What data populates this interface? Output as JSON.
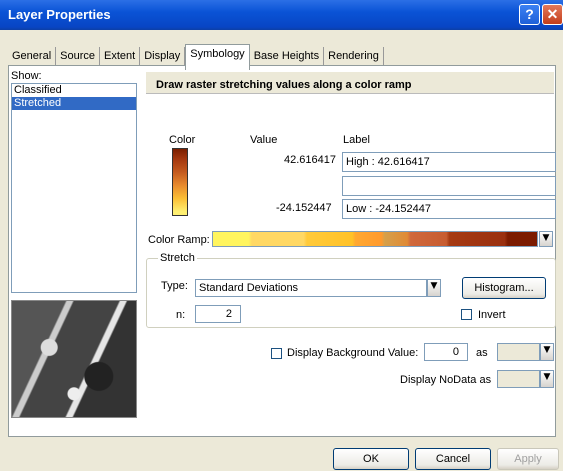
{
  "window": {
    "title": "Layer Properties"
  },
  "tabs": [
    "General",
    "Source",
    "Extent",
    "Display",
    "Symbology",
    "Base Heights",
    "Rendering"
  ],
  "active_tab": "Symbology",
  "show": {
    "label": "Show:",
    "items": [
      "Classified",
      "Stretched"
    ],
    "selected": "Stretched"
  },
  "header": "Draw raster stretching values along a color ramp",
  "columns": {
    "color": "Color",
    "value": "Value",
    "label": "Label"
  },
  "high": {
    "value": "42.616417",
    "label": "High : 42.616417"
  },
  "middle_label": "",
  "low": {
    "value": "-24.152447",
    "label": "Low : -24.152447"
  },
  "color_ramp_label": "Color Ramp:",
  "stretch": {
    "group_label": "Stretch",
    "type_label": "Type:",
    "type_value": "Standard Deviations",
    "n_label": "n:",
    "n_value": "2",
    "histogram_button": "Histogram...",
    "invert_label": "Invert"
  },
  "background": {
    "label": "Display Background Value:",
    "value": "0",
    "as_label": "as"
  },
  "nodata_label": "Display NoData as",
  "buttons": {
    "ok": "OK",
    "cancel": "Cancel",
    "apply": "Apply"
  },
  "colors": {
    "title_bar": "#0a53d6",
    "selection": "#316ac5"
  }
}
